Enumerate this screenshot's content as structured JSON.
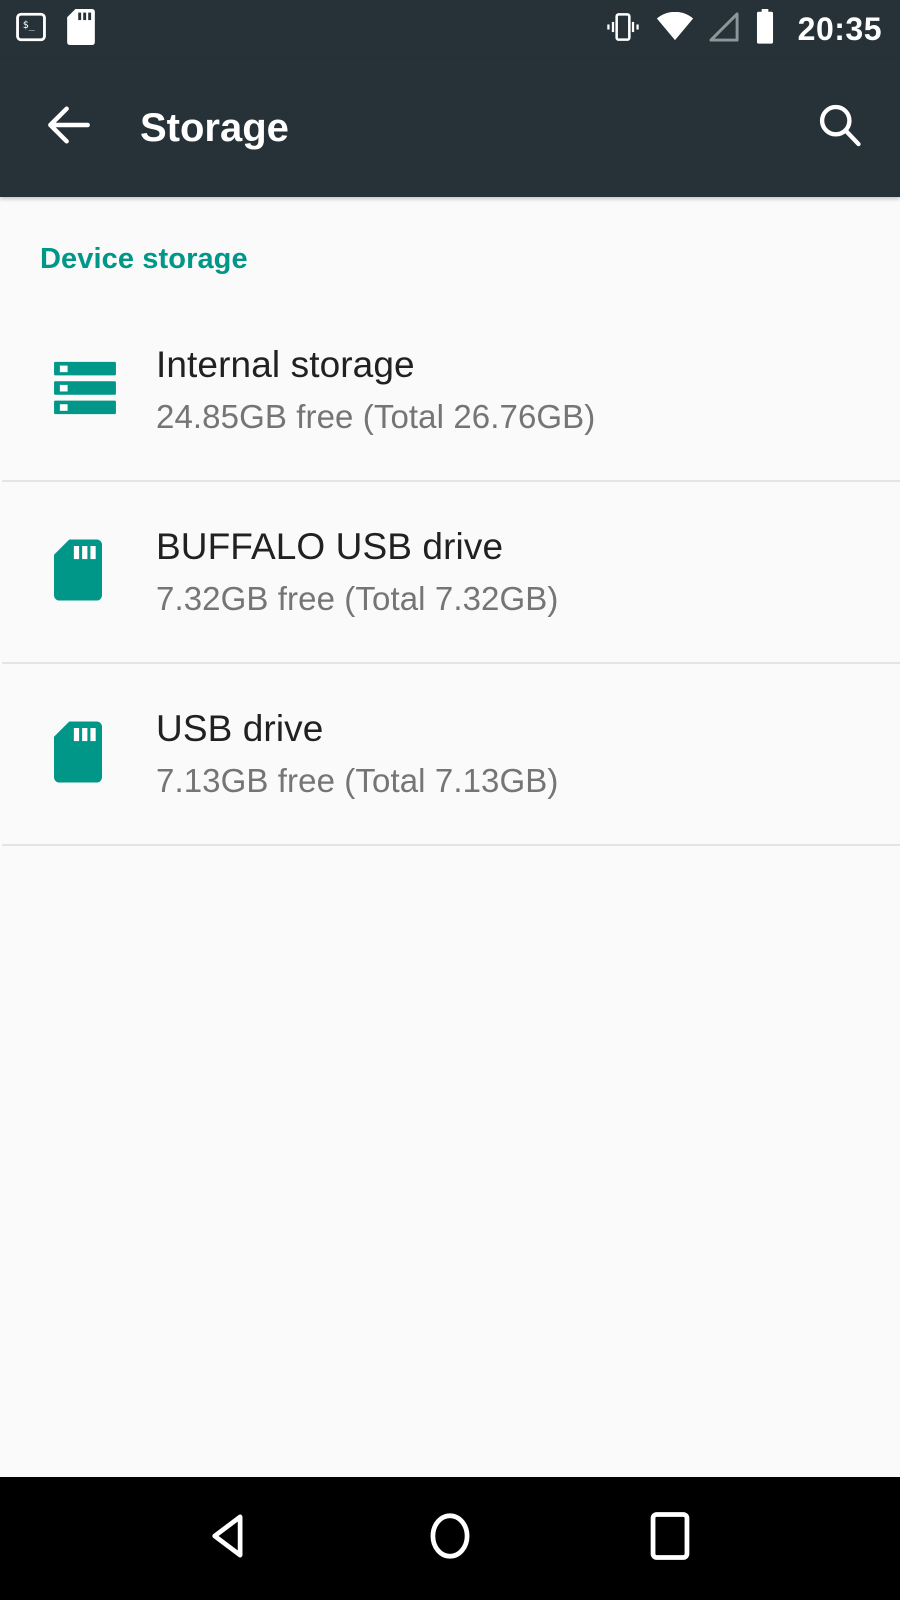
{
  "status_bar": {
    "left_icons": [
      {
        "name": "terminal-icon",
        "label": "Terminal"
      },
      {
        "name": "sd-card-icon",
        "label": "SD card"
      }
    ],
    "right_icons": [
      {
        "name": "vibrate-icon",
        "label": "Vibrate"
      },
      {
        "name": "wifi-icon",
        "label": "Wi-Fi full"
      },
      {
        "name": "cellular-signal-icon",
        "label": "No signal"
      },
      {
        "name": "battery-icon",
        "label": "Battery full"
      }
    ],
    "clock": "20:35",
    "background_color": "#263238"
  },
  "app_bar": {
    "title": "Storage",
    "back_icon": "arrow-back-icon",
    "search_icon": "search-icon",
    "background_color": "#263238",
    "title_color": "#ffffff"
  },
  "content": {
    "section_header": "Device storage",
    "accent_color": "#009688",
    "background_color": "#fafafa",
    "items": [
      {
        "icon": "internal-storage-icon",
        "title": "Internal storage",
        "subtitle": "24.85GB free (Total 26.76GB)",
        "free": "24.85GB",
        "total": "26.76GB"
      },
      {
        "icon": "usb-drive-icon",
        "title": "BUFFALO USB drive",
        "subtitle": "7.32GB free (Total 7.32GB)",
        "free": "7.32GB",
        "total": "7.32GB"
      },
      {
        "icon": "usb-drive-icon",
        "title": "USB drive",
        "subtitle": "7.13GB free (Total 7.13GB)",
        "free": "7.13GB",
        "total": "7.13GB"
      }
    ]
  },
  "nav_bar": {
    "background_color": "#000000",
    "buttons": [
      {
        "name": "nav-back-button",
        "icon": "triangle-back-icon",
        "label": "Back"
      },
      {
        "name": "nav-home-button",
        "icon": "circle-home-icon",
        "label": "Home"
      },
      {
        "name": "nav-recents-button",
        "icon": "square-recents-icon",
        "label": "Recents"
      }
    ]
  }
}
